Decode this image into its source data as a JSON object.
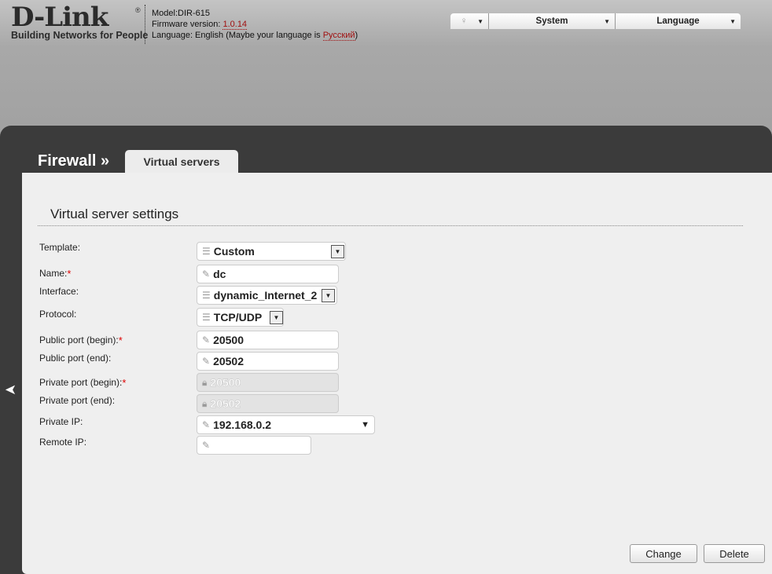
{
  "header": {
    "logo": "D-Link",
    "tagline": "Building Networks for People",
    "model": "Model:DIR-615",
    "firmware_label": "Firmware version: ",
    "firmware": "1.0.14",
    "language_text": "Language: English (Maybe your language is ",
    "language_link": "Русский",
    "language_end": ")"
  },
  "topmenu": {
    "system": "System",
    "language": "Language"
  },
  "nav": {
    "section": "Firewall »",
    "tab": "Virtual servers"
  },
  "form": {
    "title": "Virtual server settings",
    "template_label": "Template:",
    "template": "Custom",
    "name_label": "Name:",
    "name": "dc",
    "interface_label": "Interface:",
    "interface": "dynamic_Internet_2",
    "protocol_label": "Protocol:",
    "protocol": "TCP/UDP",
    "pub_begin_label": "Public port (begin):",
    "pub_begin": "20500",
    "pub_end_label": "Public port (end):",
    "pub_end": "20502",
    "priv_begin_label": "Private port (begin):",
    "priv_begin": "20500",
    "priv_end_label": "Private port (end):",
    "priv_end": "20502",
    "private_ip_label": "Private IP:",
    "private_ip": "192.168.0.2",
    "remote_ip_label": "Remote IP:",
    "remote_ip": ""
  },
  "buttons": {
    "change": "Change",
    "delete": "Delete"
  }
}
